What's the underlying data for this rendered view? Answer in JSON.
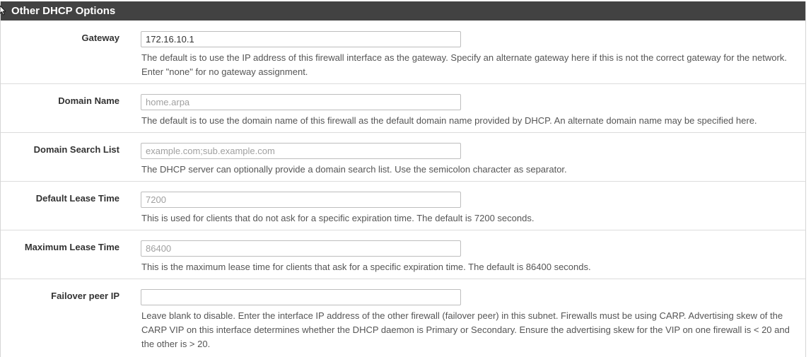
{
  "panel": {
    "title": "Other DHCP Options"
  },
  "fields": {
    "gateway": {
      "label": "Gateway",
      "value": "172.16.10.1",
      "placeholder": "",
      "help": "The default is to use the IP address of this firewall interface as the gateway. Specify an alternate gateway here if this is not the correct gateway for the network. Enter \"none\" for no gateway assignment."
    },
    "domain_name": {
      "label": "Domain Name",
      "value": "",
      "placeholder": "home.arpa",
      "help": "The default is to use the domain name of this firewall as the default domain name provided by DHCP. An alternate domain name may be specified here."
    },
    "domain_search_list": {
      "label": "Domain Search List",
      "value": "",
      "placeholder": "example.com;sub.example.com",
      "help": "The DHCP server can optionally provide a domain search list. Use the semicolon character as separator."
    },
    "default_lease_time": {
      "label": "Default Lease Time",
      "value": "",
      "placeholder": "7200",
      "help": "This is used for clients that do not ask for a specific expiration time. The default is 7200 seconds."
    },
    "maximum_lease_time": {
      "label": "Maximum Lease Time",
      "value": "",
      "placeholder": "86400",
      "help": "This is the maximum lease time for clients that ask for a specific expiration time. The default is 86400 seconds."
    },
    "failover_peer_ip": {
      "label": "Failover peer IP",
      "value": "",
      "placeholder": "",
      "help": "Leave blank to disable. Enter the interface IP address of the other firewall (failover peer) in this subnet. Firewalls must be using CARP. Advertising skew of the CARP VIP on this interface determines whether the DHCP daemon is Primary or Secondary. Ensure the advertising skew for the VIP on one firewall is < 20 and the other is > 20."
    }
  },
  "colors": {
    "heading_background": "#424242",
    "heading_text": "#ffffff",
    "row_divider": "#dcdcdc"
  }
}
